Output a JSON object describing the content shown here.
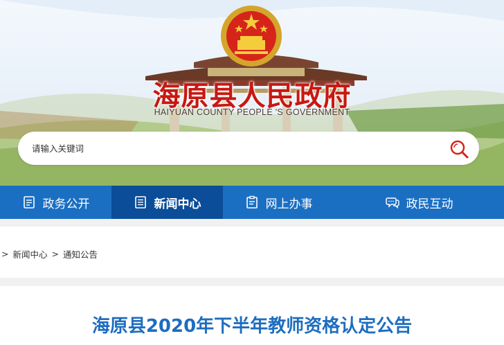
{
  "header": {
    "title": "海原县人民政府",
    "subtitle": "HAIYUAN COUNTY PEOPLE 'S GOVERNMENT"
  },
  "search": {
    "placeholder": "请输入关键词"
  },
  "nav": {
    "items": [
      {
        "label": "政务公开",
        "icon": "document-list-icon"
      },
      {
        "label": "新闻中心",
        "icon": "newspaper-icon",
        "active": true
      },
      {
        "label": "网上办事",
        "icon": "clipboard-icon"
      },
      {
        "label": "政民互动",
        "icon": "chat-bubbles-icon"
      }
    ]
  },
  "breadcrumb": {
    "items": [
      "新闻中心",
      "通知公告"
    ],
    "separator": ">"
  },
  "article": {
    "title": "海原县2020年下半年教师资格认定公告"
  },
  "colors": {
    "nav_bg": "#1b6fc3",
    "nav_active": "#0b4d98",
    "title_red": "#c81812",
    "article_title": "#1e6dbf"
  }
}
